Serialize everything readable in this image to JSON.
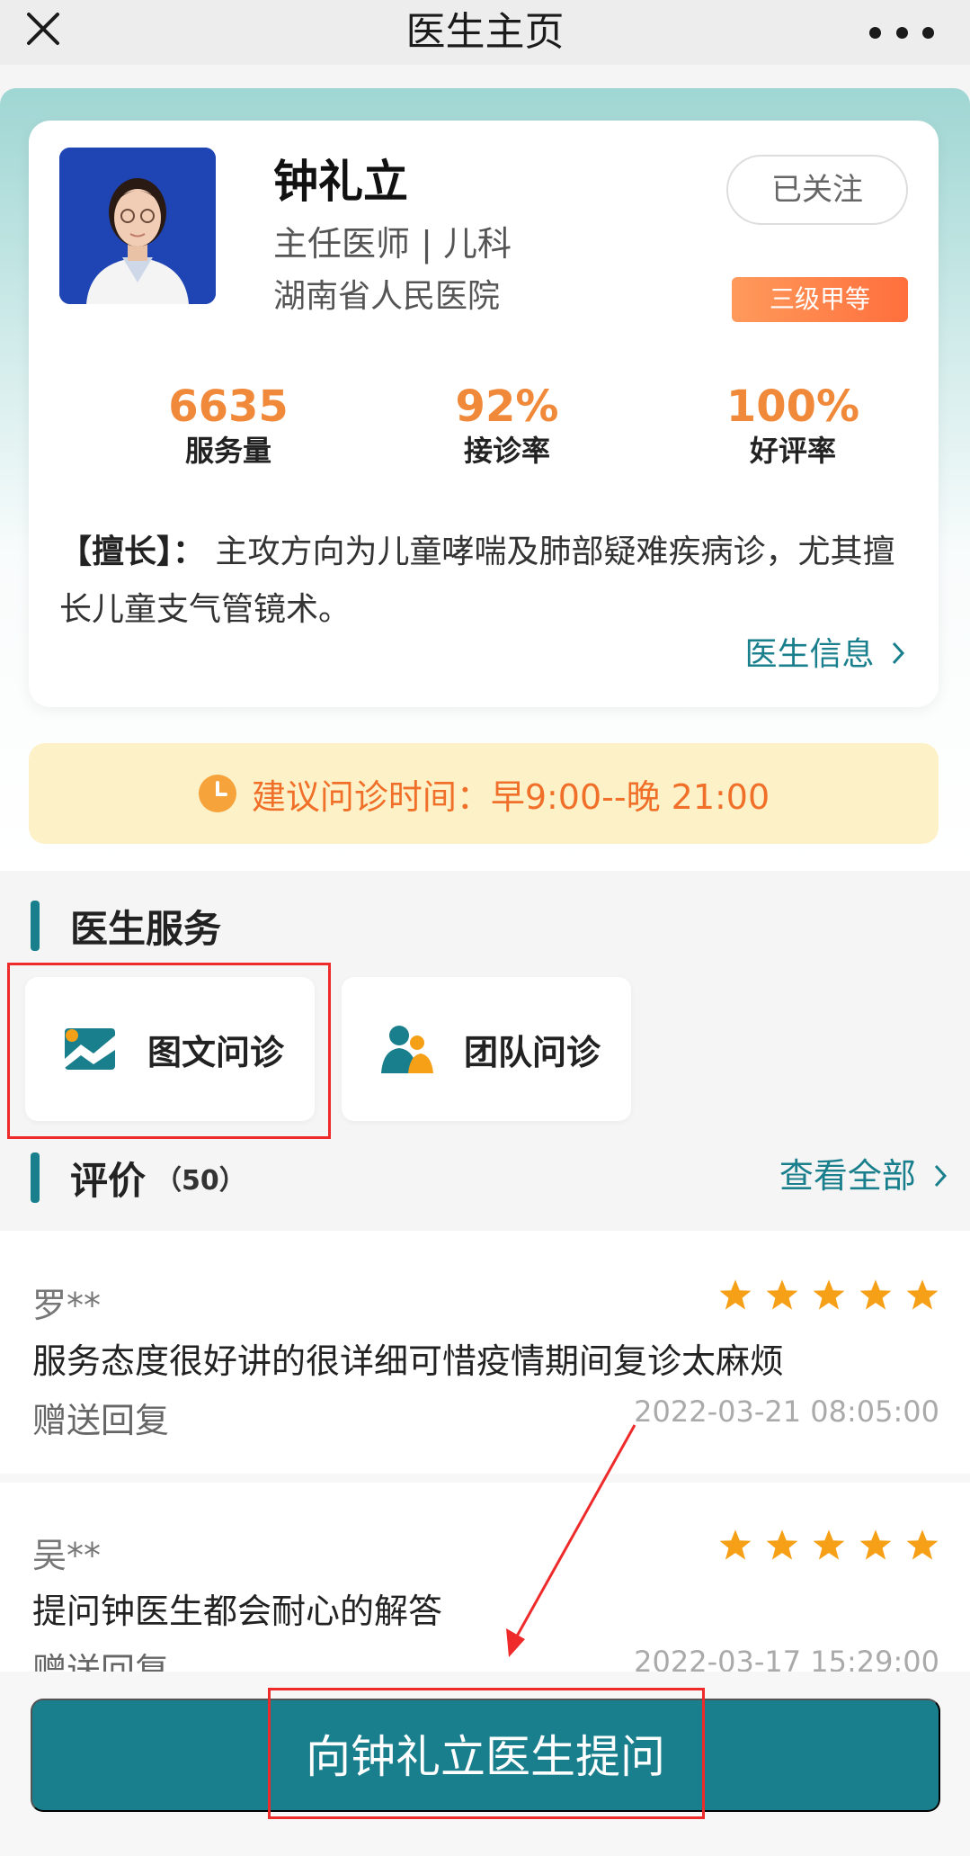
{
  "topbar": {
    "title": "医生主页"
  },
  "doctor": {
    "name": "钟礼立",
    "title": "主任医师 | 儿科",
    "hospital": "湖南省人民医院",
    "follow_label": "已关注",
    "level_badge": "三级甲等"
  },
  "stats": [
    {
      "value": "6635",
      "label": "服务量"
    },
    {
      "value": "92%",
      "label": "接诊率"
    },
    {
      "value": "100%",
      "label": "好评率"
    }
  ],
  "specialty": {
    "label": "【擅长】：",
    "text": "主攻方向为儿童哮喘及肺部疑难疾病诊，尤其擅长儿童支气管镜术。"
  },
  "doctor_info_link": "医生信息",
  "consult_time": "建议问诊时间：早9:00--晚 21:00",
  "services": {
    "title": "医生服务",
    "items": [
      {
        "label": "图文问诊",
        "icon": "image-text-icon"
      },
      {
        "label": "团队问诊",
        "icon": "team-icon"
      }
    ]
  },
  "reviews": {
    "title": "评价",
    "count": "（50）",
    "view_all": "查看全部",
    "items": [
      {
        "user": "罗**",
        "rating": 5,
        "content": "服务态度很好讲的很详细可惜疫情期间复诊太麻烦",
        "gift_label": "赠送回复",
        "time": "2022-03-21 08:05:00"
      },
      {
        "user": "吴**",
        "rating": 5,
        "content": "提问钟医生都会耐心的解答",
        "gift_label": "赠送回复",
        "time": "2022-03-17 15:29:00"
      }
    ]
  },
  "ask_button": "向钟礼立医生提问",
  "colors": {
    "accent": "#1a7f8c",
    "orange": "#f08a3a",
    "star": "#f5a017",
    "highlight_red": "#ee2a2a"
  }
}
